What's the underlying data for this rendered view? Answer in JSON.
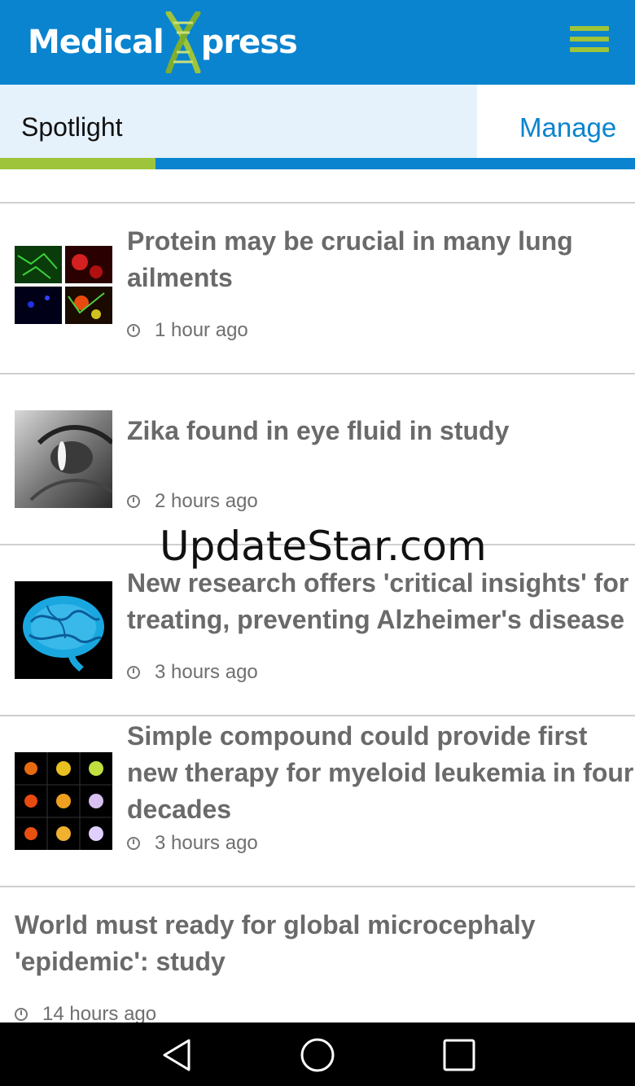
{
  "app": {
    "brand_left": "Medical",
    "brand_right": "press",
    "accent": "#0a84cf",
    "brand_green": "#9dc43a"
  },
  "tabs": {
    "spotlight": "Spotlight",
    "manage": "Manage"
  },
  "articles": [
    {
      "title": "Protein may be crucial in many lung ailments",
      "time": "1 hour ago",
      "thumb": "fluorescence-grid"
    },
    {
      "title": "Zika found in eye fluid in study",
      "time": "2 hours ago",
      "thumb": "eye-photo"
    },
    {
      "title": "New research offers 'critical insights' for treating, preventing Alzheimer's disease",
      "time": "3 hours ago",
      "thumb": "brain"
    },
    {
      "title": "Simple compound could provide first new therapy for myeloid leukemia in four decades",
      "time": "3 hours ago",
      "thumb": "cell-dots"
    },
    {
      "title": "World must ready for global microcephaly 'epidemic': study",
      "time": "14 hours ago",
      "thumb": ""
    }
  ],
  "watermark": "UpdateStar.com",
  "navbar": {
    "back": "back-icon",
    "home": "home-icon",
    "recents": "recents-icon"
  }
}
